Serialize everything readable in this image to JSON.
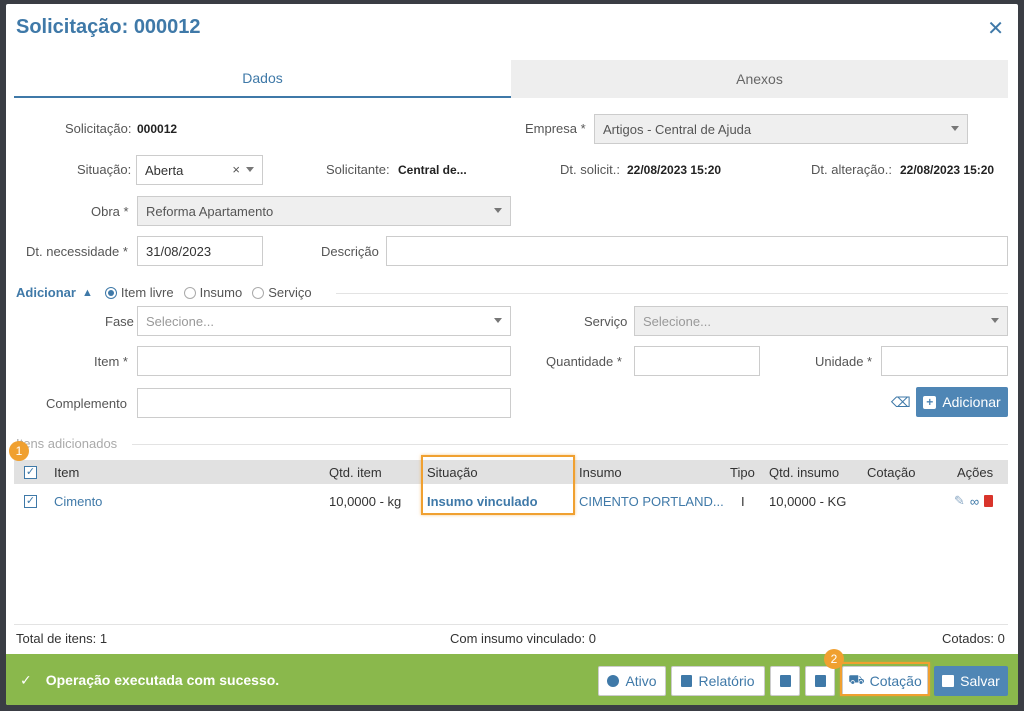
{
  "header": {
    "title": "Solicitação: 000012"
  },
  "tabs": [
    {
      "label": "Dados"
    },
    {
      "label": "Anexos"
    }
  ],
  "form": {
    "solicitacao_label": "Solicitação:",
    "solicitacao_value": "000012",
    "empresa_label": "Empresa *",
    "empresa_value": "Artigos - Central de Ajuda",
    "situacao_label": "Situação:",
    "situacao_value": "Aberta",
    "solicitante_label": "Solicitante:",
    "solicitante_value": "Central de...",
    "dt_solicit_label": "Dt. solicit.:",
    "dt_solicit_value": "22/08/2023 15:20",
    "dt_alteracao_label": "Dt. alteração.:",
    "dt_alteracao_value": "22/08/2023 15:20",
    "obra_label": "Obra *",
    "obra_value": "Reforma Apartamento",
    "dt_necessidade_label": "Dt. necessidade *",
    "dt_necessidade_value": "31/08/2023",
    "descricao_label": "Descrição"
  },
  "adicionar": {
    "toggle_label": "Adicionar",
    "radio_item_livre": "Item livre",
    "radio_insumo": "Insumo",
    "radio_servico": "Serviço",
    "fase_label": "Fase",
    "fase_placeholder": "Selecione...",
    "servico_label": "Serviço",
    "servico_placeholder": "Selecione...",
    "item_label": "Item *",
    "quantidade_label": "Quantidade *",
    "unidade_label": "Unidade *",
    "complemento_label": "Complemento",
    "add_button": "Adicionar"
  },
  "itens": {
    "section_title": "Itens adicionados",
    "columns": [
      "Item",
      "Qtd. item",
      "Situação",
      "Insumo",
      "Tipo",
      "Qtd. insumo",
      "Cotação",
      "Ações"
    ],
    "rows": [
      {
        "item": "Cimento",
        "qtd_item": "10,0000 - kg",
        "situacao": "Insumo vinculado",
        "insumo": "CIMENTO PORTLAND...",
        "tipo": "I",
        "qtd_insumo": "10,0000 - KG",
        "cotacao": ""
      }
    ]
  },
  "totals": {
    "total_itens": "Total de itens: 1",
    "com_insumo": "Com insumo vinculado: 0",
    "cotados": "Cotados: 0"
  },
  "footer": {
    "message": "Operação executada com sucesso.",
    "ativo": "Ativo",
    "relatorio": "Relatório",
    "cotacao": "Cotação",
    "salvar": "Salvar"
  },
  "annotations": {
    "badge1": "1",
    "badge2": "2"
  },
  "colors": {
    "accent": "#3f79a8",
    "success": "#8ab84c",
    "highlight": "#f0a030",
    "delete": "#d9342b"
  }
}
